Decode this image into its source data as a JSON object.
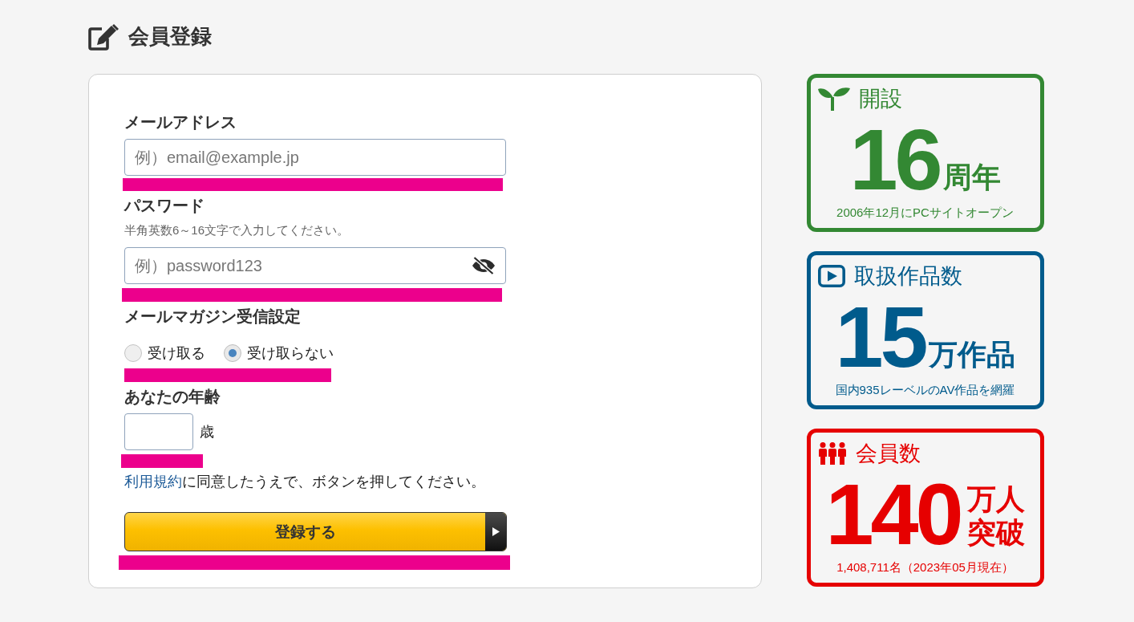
{
  "page_title": "会員登録",
  "form": {
    "fields": [
      {
        "kind": "email",
        "label": "メールアドレス",
        "placeholder": "例）email@example.jp",
        "marked": true
      },
      {
        "kind": "password",
        "label": "パスワード",
        "hint": "半角英数6～16文字で入力してください。",
        "placeholder": "例）password123",
        "marked": true
      },
      {
        "kind": "radio",
        "label": "メールマガジン受信設定",
        "options": [
          {
            "label": "受け取る",
            "selected": false
          },
          {
            "label": "受け取らない",
            "selected": true
          }
        ],
        "marked": true
      },
      {
        "kind": "age",
        "label": "あなたの年齢",
        "unit": "歳",
        "marked": true
      }
    ],
    "terms": {
      "link": "利用規約",
      "text": "に同意したうえで、ボタンを押してください。"
    },
    "submit": {
      "label": "登録する",
      "marked": true
    }
  },
  "stats": [
    {
      "kind": "founded",
      "color": "#338833",
      "title": "開設",
      "value": "16",
      "unit": [
        "周年"
      ],
      "note": "2006年12月にPCサイトオープン"
    },
    {
      "kind": "titles",
      "color": "#005b8c",
      "title": "取扱作品数",
      "value": "15",
      "unit": [
        "万作品"
      ],
      "note": "国内935レーベルのAV作品を網羅"
    },
    {
      "kind": "members",
      "color": "#e60000",
      "title": "会員数",
      "value": "140",
      "unit": [
        "万人",
        "突破"
      ],
      "note": "1,408,711名（2023年05月現在）"
    }
  ]
}
